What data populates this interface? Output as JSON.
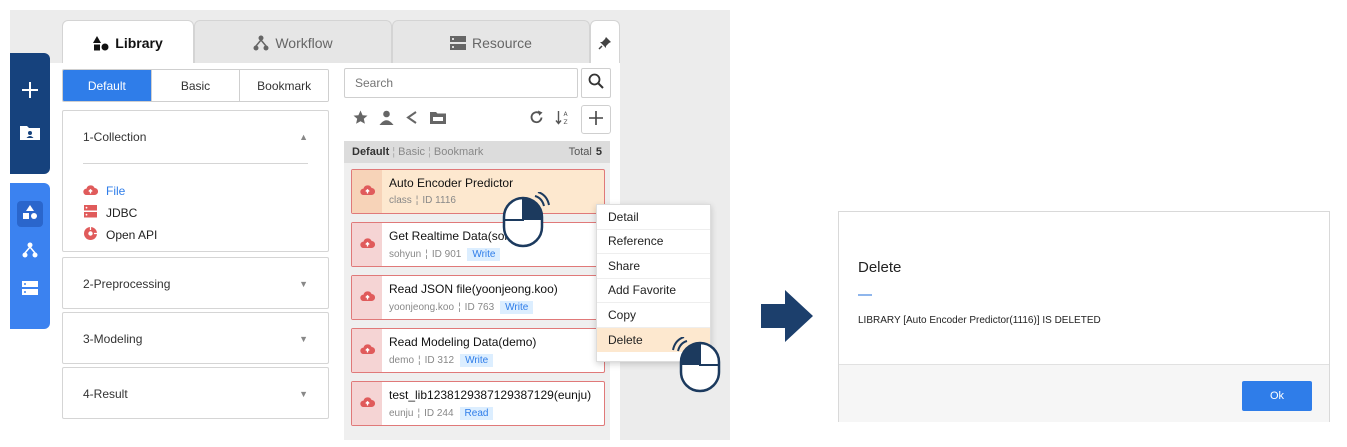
{
  "tabs": [
    {
      "label": "Library",
      "active": true
    },
    {
      "label": "Workflow",
      "active": false
    },
    {
      "label": "Resource",
      "active": false
    }
  ],
  "segments": [
    {
      "label": "Default",
      "active": true
    },
    {
      "label": "Basic",
      "active": false
    },
    {
      "label": "Bookmark",
      "active": false
    }
  ],
  "accordion": [
    {
      "title": "1-Collection",
      "expanded": true,
      "items": [
        {
          "label": "File",
          "icon": "cloud-upload-icon",
          "selected": true
        },
        {
          "label": "JDBC",
          "icon": "database-icon",
          "selected": false
        },
        {
          "label": "Open API",
          "icon": "api-icon",
          "selected": false
        }
      ]
    },
    {
      "title": "2-Preprocessing",
      "expanded": false
    },
    {
      "title": "3-Modeling",
      "expanded": false
    },
    {
      "title": "4-Result",
      "expanded": false
    }
  ],
  "search": {
    "placeholder": "Search"
  },
  "list_header": {
    "default": "Default",
    "basic": "Basic",
    "bookmark": "Bookmark",
    "total_label": "Total",
    "total": "5"
  },
  "cards": [
    {
      "name": "Auto Encoder Predictor",
      "owner": "class",
      "id": "ID 1116",
      "badge": ""
    },
    {
      "name": "Get Realtime Data(sohyu",
      "owner": "sohyun",
      "id": "ID 901",
      "badge": "Write"
    },
    {
      "name": "Read JSON file(yoonjeong.koo)",
      "owner": "yoonjeong.koo",
      "id": "ID 763",
      "badge": "Write"
    },
    {
      "name": "Read Modeling Data(demo)",
      "owner": "demo",
      "id": "ID 312",
      "badge": "Write"
    },
    {
      "name": "test_lib1238129387129387129(eunju)",
      "owner": "eunju",
      "id": "ID 244",
      "badge": "Read"
    }
  ],
  "context_menu": [
    "Detail",
    "Reference",
    "Share",
    "Add Favorite",
    "Copy",
    "Delete"
  ],
  "dialog": {
    "title": "Delete",
    "message": "LIBRARY [Auto Encoder Predictor(1116)] IS DELETED",
    "ok": "Ok"
  },
  "colors": {
    "primary": "#2f7de9",
    "navy": "#16427d",
    "rail_blue": "#3b82f0",
    "card_border": "#e07979",
    "highlight": "#fde8cf"
  }
}
